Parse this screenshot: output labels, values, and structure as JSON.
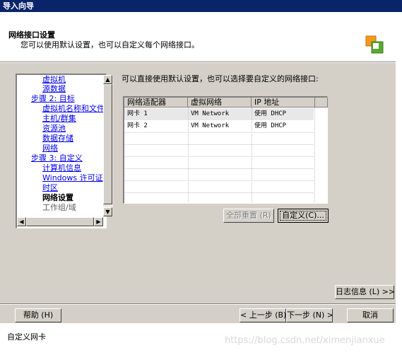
{
  "window": {
    "title": "导入向导"
  },
  "header": {
    "title": "网络接口设置",
    "subtitle": "您可以使用默认设置，也可以自定义每个网络接口。",
    "logo_icon": "vmware-logo-icon"
  },
  "sidebar": {
    "items": [
      {
        "label": "虚拟机",
        "type": "link"
      },
      {
        "label": "源数据",
        "type": "link"
      },
      {
        "label": "步骤 2: 目标",
        "type": "link"
      },
      {
        "label": "虚拟机名称和文件",
        "type": "link"
      },
      {
        "label": "主机/群集",
        "type": "link"
      },
      {
        "label": "资源池",
        "type": "link"
      },
      {
        "label": "数据存储",
        "type": "link"
      },
      {
        "label": "网络",
        "type": "link"
      },
      {
        "label": "步骤 3: 自定义",
        "type": "link"
      },
      {
        "label": "计算机信息",
        "type": "link"
      },
      {
        "label": "Windows 许可证",
        "type": "link"
      },
      {
        "label": "时区",
        "type": "link"
      },
      {
        "label": "网络设置",
        "type": "current"
      },
      {
        "label": "工作组/域",
        "type": "disabled"
      }
    ]
  },
  "main": {
    "instruction": "可以直接使用默认设置，也可以选择要自定义的网络接口:",
    "table": {
      "columns": [
        "网络适配器",
        "虚拟网络",
        "IP 地址"
      ],
      "rows": [
        [
          "网卡 1",
          "VM Network",
          "使用 DHCP"
        ],
        [
          "网卡 2",
          "VM Network",
          "使用 DHCP"
        ]
      ]
    },
    "reset_all_label": "全部重置 (R)",
    "customize_label": "自定义(C)..."
  },
  "footer": {
    "log_label": "日志信息 (L) >>",
    "help_label": "帮助 (H)",
    "back_label": "< 上一步 (B)",
    "next_label": "下一步 (N) >",
    "cancel_label": "取消"
  },
  "caption": "自定义网卡",
  "watermark": "https://blog.csdn.net/ximenjianxue",
  "colors": {
    "titlebar": "#0a246a",
    "dialog_bg": "#d4d0c8",
    "link": "#0000ee"
  }
}
